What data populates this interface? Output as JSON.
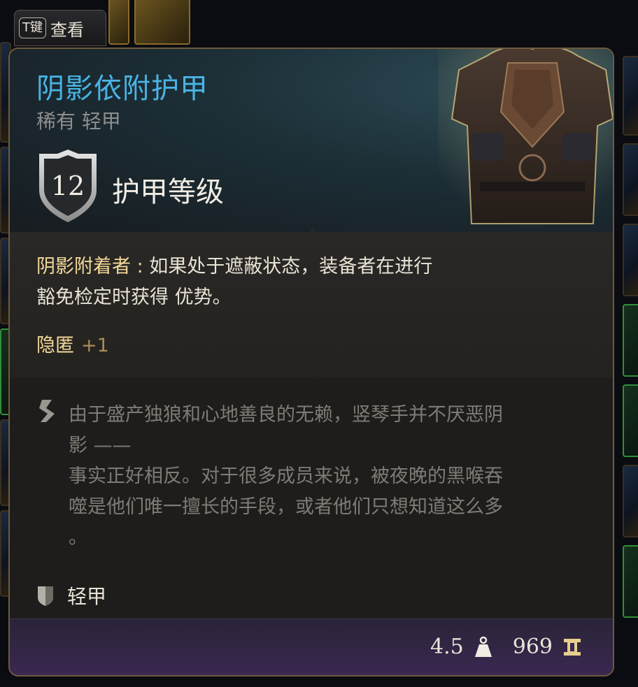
{
  "hint": {
    "key": "T键",
    "label": "查看"
  },
  "item": {
    "name": "阴影依附护甲",
    "subtitle": "稀有 轻甲",
    "armor_value": "12",
    "armor_label": "护甲等级"
  },
  "effects": {
    "ability_name": "阴影附着者 :",
    "line1": " 如果处于遮蔽状态，装备者在进行",
    "line2": "豁免检定时获得 优势。",
    "stealth_label": "隐匿",
    "stealth_value": "+1"
  },
  "lore": {
    "line1": "由于盛产独狼和心地善良的无赖，竖琴手并不厌恶阴",
    "line2": "影 ——",
    "line3": "事实正好相反。对于很多成员来说，被夜晚的黑喉吞",
    "line4": "噬是他们唯一擅长的手段，或者他们只想知道这么多",
    "line5": "。"
  },
  "type_label": "轻甲",
  "footer": {
    "weight": "4.5",
    "price": "969"
  },
  "icons": {
    "shield": "armor-class-shield-icon",
    "lore": "lore-quill-icon",
    "type": "light-armor-icon",
    "weight": "weight-icon",
    "price": "gold-coin-icon"
  },
  "colors": {
    "title": "#49b4e4",
    "effect_name": "#f3d99a",
    "lore_text": "#7f7b74",
    "border": "#6e5a3c",
    "footer": "#3a2850"
  }
}
